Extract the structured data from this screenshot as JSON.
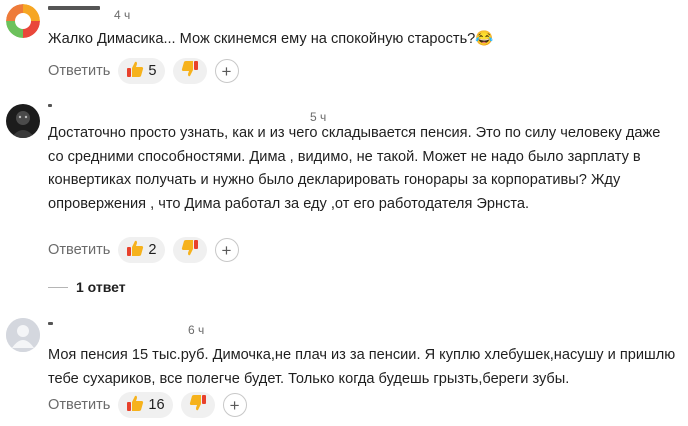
{
  "comments": [
    {
      "time": "4 ч",
      "text": "Жалко Димасика... Мож скинемся ему на спокойную старость?😂",
      "reply_label": "Ответить",
      "likes": "5",
      "likes_icon": "thumbs-up-icon",
      "dislikes_icon": "thumbs-down-icon"
    },
    {
      "time": "5 ч",
      "text": "Достаточно просто узнать, как и из чего складывается пенсия. Это по силу человеку даже со средними способностями. Дима , видимо, не такой. Может не надо было зарплату в конвертиках получать и нужно было декларировать гонорары за корпоративы? Жду опровержения , что Дима работал за еду ,от его работодателя Эрнста.",
      "reply_label": "Ответить",
      "likes": "2",
      "replies_label": "1 ответ"
    },
    {
      "time": "6 ч",
      "text": "Моя пенсия 15 тыс.руб. Димочка,не плач из за пенсии. Я куплю хлебушек,насушу и пришлю тебе сухариков, все полегче будет. Только когда будешь грызть,береги зубы.",
      "reply_label": "Ответить",
      "likes": "16"
    }
  ],
  "colors": {
    "text": "#1f1f1f",
    "muted": "#6b6b6b",
    "pill_bg": "#f0f0f0",
    "reaction_yellow": "#f6b21c",
    "reaction_red": "#e8412c"
  }
}
